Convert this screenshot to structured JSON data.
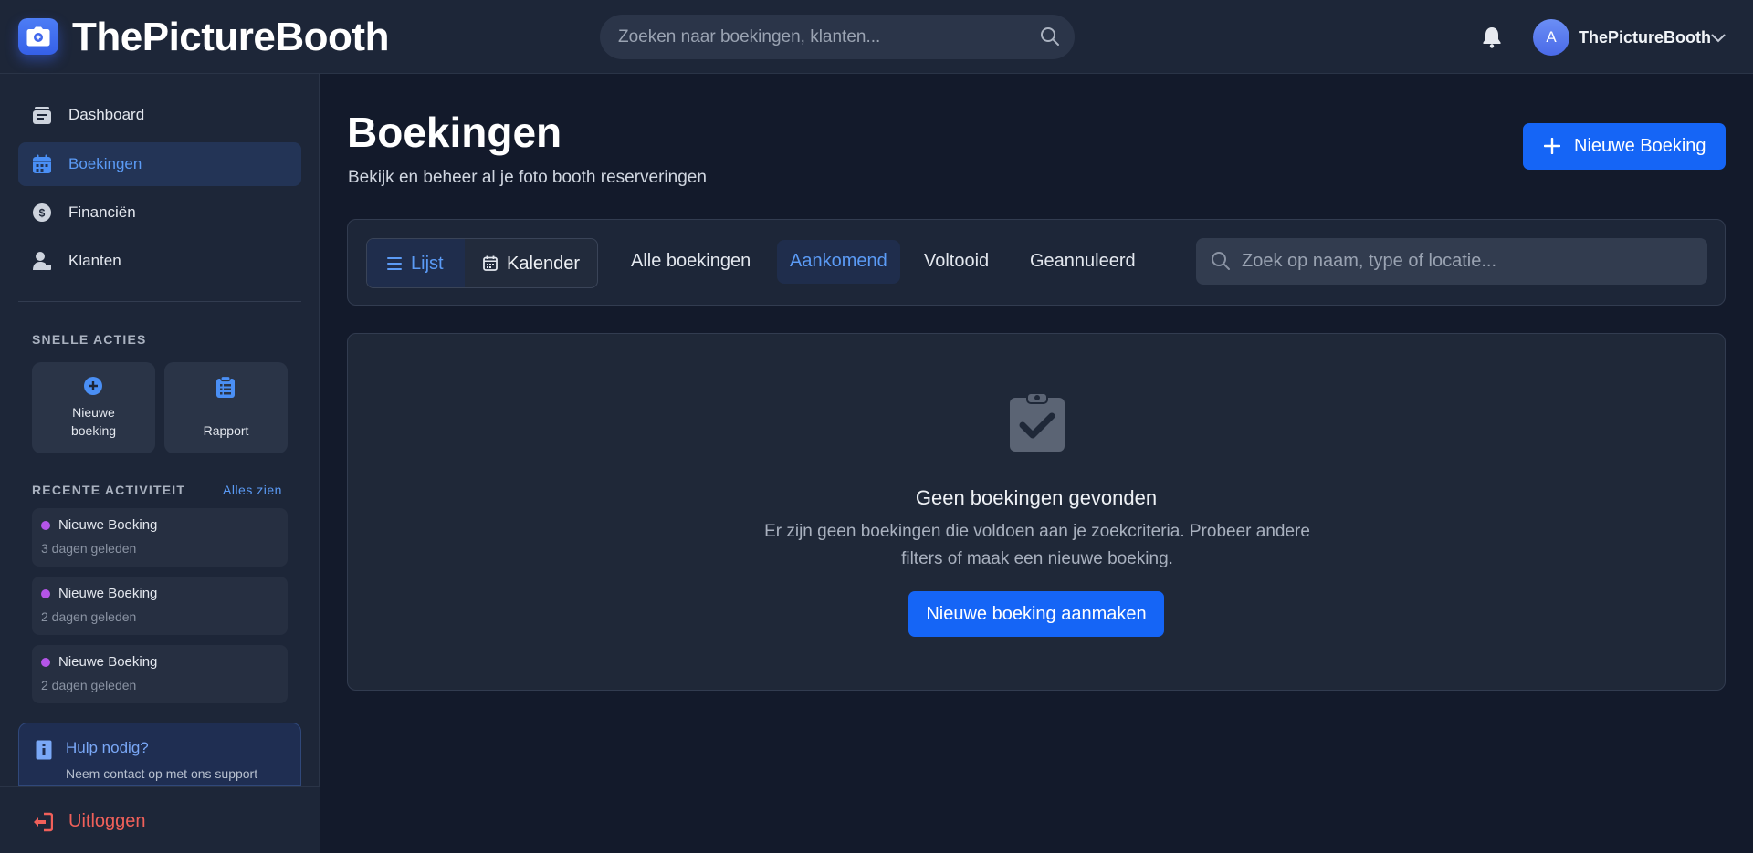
{
  "app": {
    "name": "ThePictureBooth"
  },
  "header": {
    "search_placeholder": "Zoeken naar boekingen, klanten...",
    "user": {
      "initial": "A",
      "name": "ThePictureBooth"
    }
  },
  "sidebar": {
    "nav": [
      {
        "label": "Dashboard",
        "icon": "dashboard-icon",
        "active": false
      },
      {
        "label": "Boekingen",
        "icon": "calendar-icon",
        "active": true
      },
      {
        "label": "Financiën",
        "icon": "dollar-icon",
        "active": false
      },
      {
        "label": "Klanten",
        "icon": "user-icon",
        "active": false
      }
    ],
    "quick_actions": {
      "title": "SNELLE ACTIES",
      "items": [
        {
          "label": "Nieuwe boeking",
          "icon": "plus-circle-icon"
        },
        {
          "label": "Rapport",
          "icon": "clipboard-list-icon"
        }
      ]
    },
    "recent": {
      "title": "RECENTE ACTIVITEIT",
      "see_all": "Alles zien",
      "items": [
        {
          "title": "Nieuwe Boeking",
          "time": "3 dagen geleden"
        },
        {
          "title": "Nieuwe Boeking",
          "time": "2 dagen geleden"
        },
        {
          "title": "Nieuwe Boeking",
          "time": "2 dagen geleden"
        }
      ]
    },
    "help": {
      "title": "Hulp nodig?",
      "description": "Neem contact op met ons support"
    },
    "logout": "Uitloggen"
  },
  "main": {
    "title": "Boekingen",
    "subtitle": "Bekijk en beheer al je foto booth reserveringen",
    "new_button": "Nieuwe Boeking",
    "view_toggle": {
      "list": "Lijst",
      "calendar": "Kalender",
      "selected": "Lijst"
    },
    "tabs": [
      {
        "label": "Alle boekingen",
        "active": false
      },
      {
        "label": "Aankomend",
        "active": true
      },
      {
        "label": "Voltooid",
        "active": false
      },
      {
        "label": "Geannuleerd",
        "active": false
      }
    ],
    "filter_search_placeholder": "Zoek op naam, type of locatie...",
    "empty_state": {
      "icon": "clipboard-check-icon",
      "title": "Geen boekingen gevonden",
      "description": "Er zijn geen boekingen die voldoen aan je zoekcriteria. Probeer andere filters of maak een nieuwe boeking.",
      "button": "Nieuwe boeking aanmaken"
    }
  },
  "colors": {
    "accent": "#1565f6",
    "active_text": "#5b9bf6",
    "activity_dot": "#b455e8",
    "logout": "#f0605a"
  }
}
